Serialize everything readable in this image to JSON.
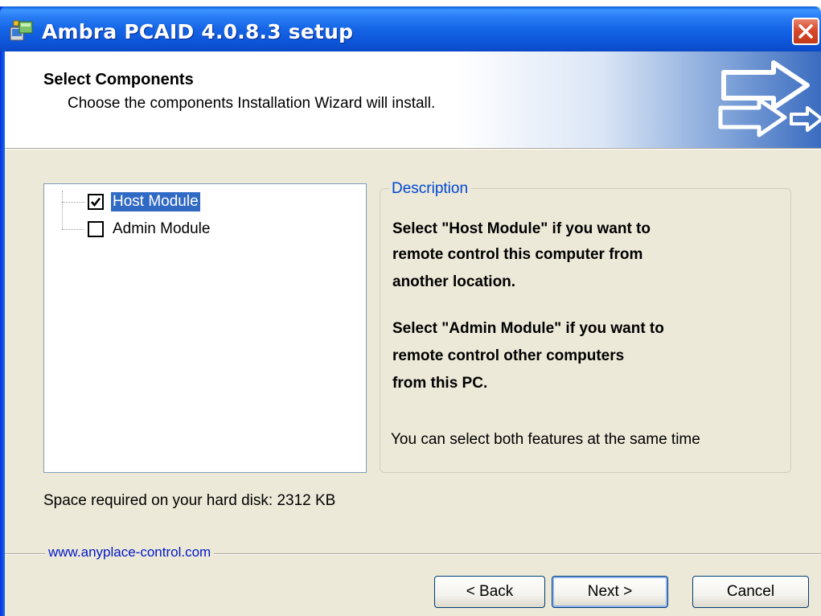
{
  "window": {
    "title": "Ambra PCAID 4.0.8.3 setup"
  },
  "header": {
    "title": "Select Components",
    "subtitle": "Choose the components Installation Wizard will install."
  },
  "components": [
    {
      "label": "Host Module",
      "checked": true,
      "selected": true
    },
    {
      "label": "Admin Module",
      "checked": false,
      "selected": false
    }
  ],
  "description": {
    "legend": "Description",
    "host_lines": [
      "Select \"Host Module\" if you want to",
      "remote control this computer from",
      "another location."
    ],
    "admin_lines": [
      "Select \"Admin Module\" if you want to",
      "remote control other computers",
      "from this PC."
    ],
    "note": "You can select both features at the same time"
  },
  "space_required": "Space required on your hard disk: 2312 KB",
  "footer": {
    "link": "www.anyplace-control.com"
  },
  "buttons": {
    "back": "< Back",
    "next": "Next >",
    "cancel": "Cancel"
  },
  "colors": {
    "title_bar": "#0a5fd8",
    "selection": "#316ac5",
    "legend": "#0046d5",
    "link": "#0018c8",
    "close": "#d7492a"
  },
  "icons": {
    "app": "installer-icon",
    "close": "close-icon",
    "header": "arrows-icon",
    "check": "check-icon"
  }
}
